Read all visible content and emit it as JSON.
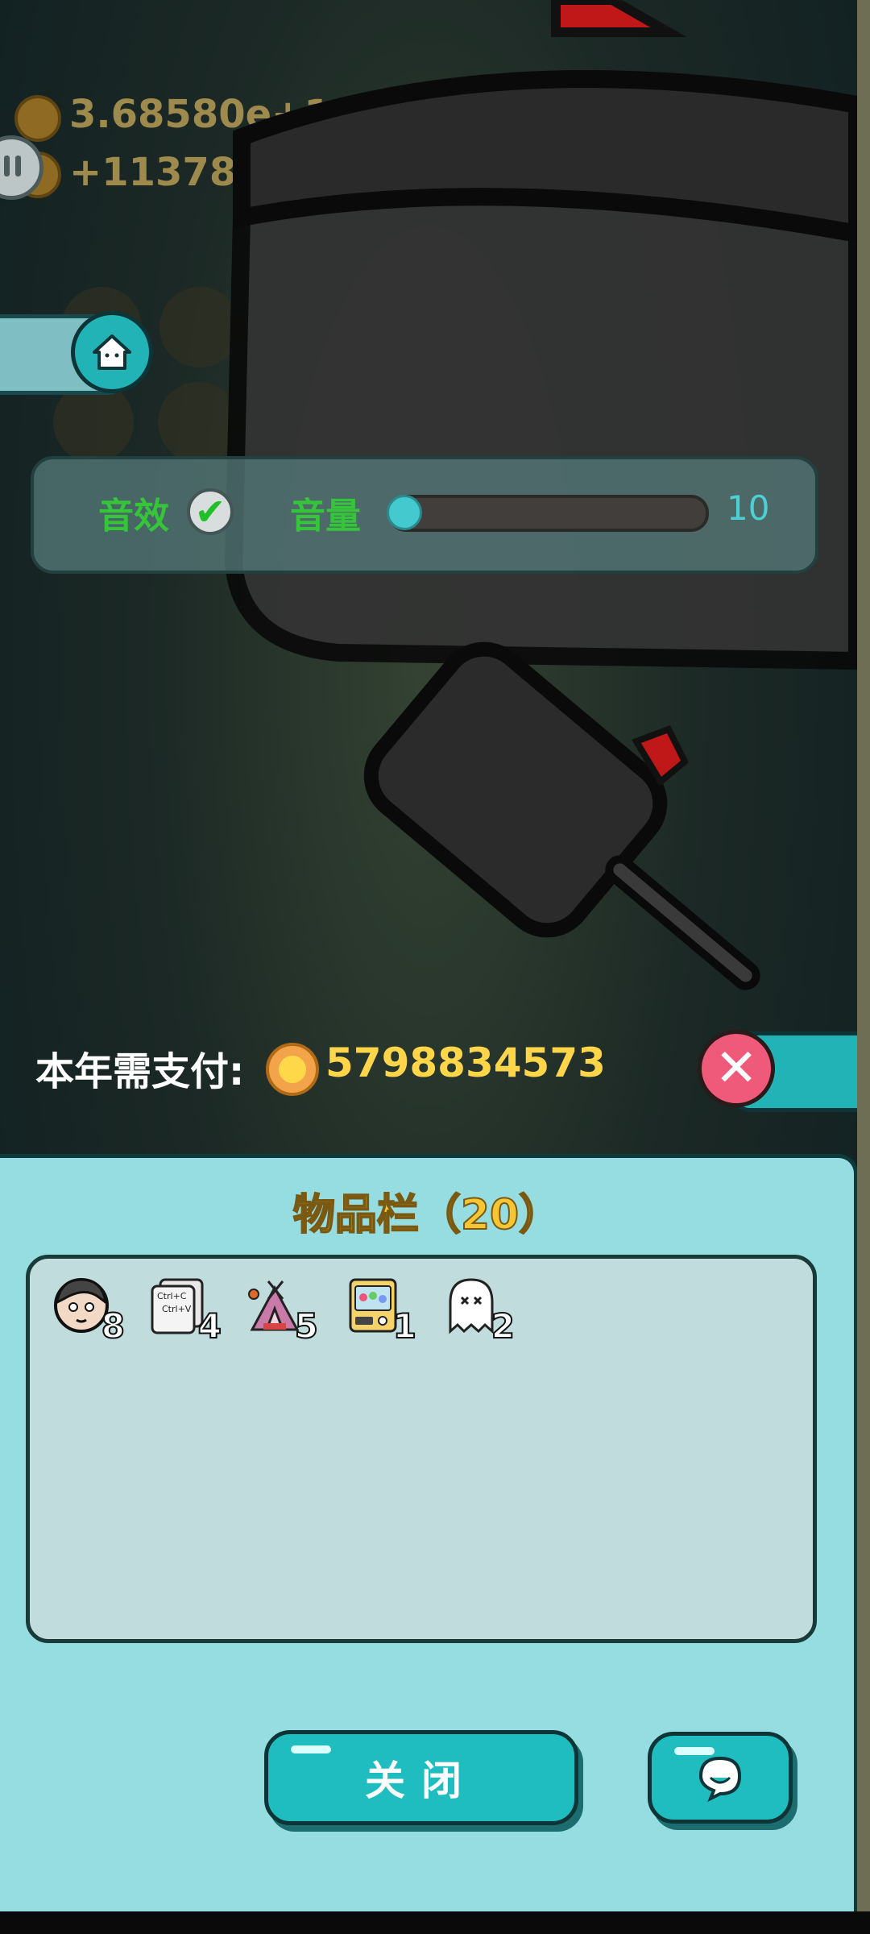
{
  "hud": {
    "total_coins": "3.68580e+1",
    "income_rate": "+11378"
  },
  "settings": {
    "sfx_label": "音效",
    "sfx_enabled": true,
    "volume_label": "音量",
    "volume_value": "10",
    "volume_level_fraction": 0.0
  },
  "payment": {
    "label": "本年需支付:",
    "amount": "5798834573"
  },
  "inventory": {
    "title": "物品栏（20）",
    "items": [
      {
        "icon": "portrait-icon",
        "count": "8"
      },
      {
        "icon": "copy-paste-card-icon",
        "count": "4"
      },
      {
        "icon": "tent-icon",
        "count": "5"
      },
      {
        "icon": "vending-machine-icon",
        "count": "1"
      },
      {
        "icon": "ghost-icon",
        "count": "2"
      }
    ],
    "close_label": "关闭"
  },
  "colors": {
    "panel_bg": "#95dde0",
    "accent_teal": "#1fbcc0",
    "coin_yellow": "#ffd64a",
    "sfx_green": "#35c43a",
    "close_pink": "#ef5a7a"
  }
}
